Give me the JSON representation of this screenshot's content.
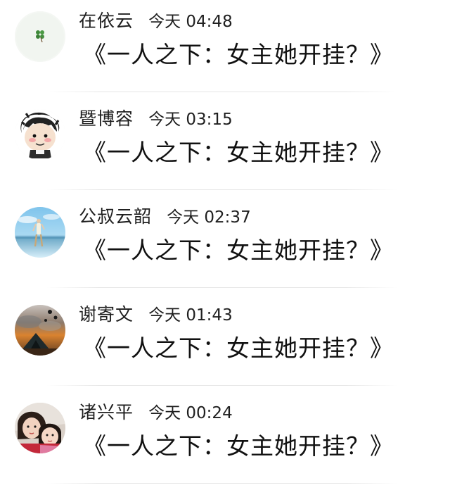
{
  "comments": [
    {
      "username": "在依云",
      "time": "今天 04:48",
      "text": "《一人之下：女主她开挂？》",
      "avatar": "clover-icon"
    },
    {
      "username": "暨博容",
      "time": "今天 03:15",
      "text": "《一人之下：女主她开挂？》",
      "avatar": "cartoon-boy-avatar"
    },
    {
      "username": "公叔云韶",
      "time": "今天 02:37",
      "text": "《一人之下：女主她开挂？》",
      "avatar": "sky-figure-avatar"
    },
    {
      "username": "谢寄文",
      "time": "今天 01:43",
      "text": "《一人之下：女主她开挂？》",
      "avatar": "sunset-landscape-avatar"
    },
    {
      "username": "诸兴平",
      "time": "今天 00:24",
      "text": "《一人之下：女主她开挂？》",
      "avatar": "two-girls-photo-avatar"
    }
  ]
}
